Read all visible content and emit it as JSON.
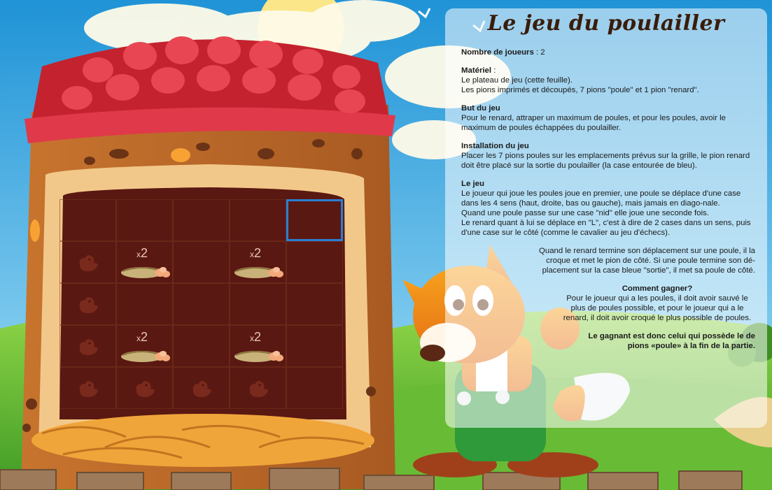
{
  "title": "Le jeu du poulailler",
  "players": {
    "label": "Nombre de joueurs",
    "value": " : 2"
  },
  "materiel": {
    "heading": "Matériel",
    "suffix": " :",
    "line1": "Le plateau de jeu (cette feuille).",
    "line2": "Les pions imprimés et découpés, 7 pions \"poule\" et 1 pion \"renard\"."
  },
  "but": {
    "heading": "But du jeu",
    "text": "Pour le renard, attraper un maximum de poules, et pour les poules, avoir le maximum de poules échappées du poulailler."
  },
  "installation": {
    "heading": "Installation du jeu",
    "text": "Placer les 7 pions poules sur les emplacements prévus sur la grille, le pion renard doit être placé sur la sortie du poulailler (la case entourée de bleu)."
  },
  "jeu": {
    "heading": "Le jeu",
    "p1": "Le joueur qui joue les poules joue en premier, une poule se déplace d'une case dans les 4 sens (haut, droite, bas ou gauche), mais jamais en diago-nale.",
    "p2": "Quand une poule passe sur une case \"nid\" elle joue une seconde fois.",
    "p3": "Le renard quant à lui se déplace en \"L\", c'est à dire de 2 cases dans un sens, puis d'une case sur le côté (comme le cavalier au jeu d'échecs).",
    "p4": "Quand le renard termine son déplacement sur une poule, il la croque et met le pion de côté. Si une poule termine son dé-placement sur la case bleue \"sortie\", il met sa poule de côté."
  },
  "gagner": {
    "heading": "Comment gagner?",
    "text": "Pour le joueur qui a les poules, il doit avoir sauvé le plus de poules possible, et pour le joueur qui a le renard, il doit avoir croqué le plus possible de poules."
  },
  "conclusion": "Le gagnant est donc celui qui possède le de pions «poule» à la fin de la partie.",
  "board": {
    "nest_multiplier": "x",
    "nest_number": "2",
    "cells": [
      [
        "empty",
        "empty",
        "empty",
        "empty",
        "exit"
      ],
      [
        "hen",
        "nest",
        "empty",
        "nest",
        "empty"
      ],
      [
        "hen",
        "empty",
        "empty",
        "empty",
        "empty"
      ],
      [
        "hen",
        "nest",
        "empty",
        "nest",
        "empty"
      ],
      [
        "hen",
        "hen",
        "hen",
        "hen",
        "empty"
      ]
    ]
  },
  "colors": {
    "sky": "#3aa7e0",
    "roof": "#c4222e",
    "board": "#5a1812",
    "exit_outline": "#2a7fd4",
    "fox": "#ef8a1a",
    "overalls": "#2f9a3a"
  }
}
